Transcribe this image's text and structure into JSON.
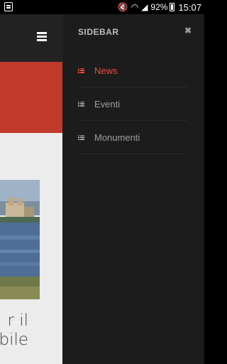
{
  "status_bar": {
    "battery_percent": "92%",
    "time": "15:07"
  },
  "page": {
    "partial_text_line1": "r il",
    "partial_text_line2": "bile"
  },
  "sidebar": {
    "title": "SIDEBAR",
    "close_glyph": "✖",
    "items": [
      {
        "label": "News",
        "active": true,
        "color": "#e74c3c"
      },
      {
        "label": "Eventi",
        "active": false,
        "color": "#9e9e9e"
      },
      {
        "label": "Monumenti",
        "active": false,
        "color": "#9e9e9e"
      }
    ]
  },
  "colors": {
    "accent_red": "#c0392b",
    "sidebar_bg": "#1c1c1c"
  }
}
